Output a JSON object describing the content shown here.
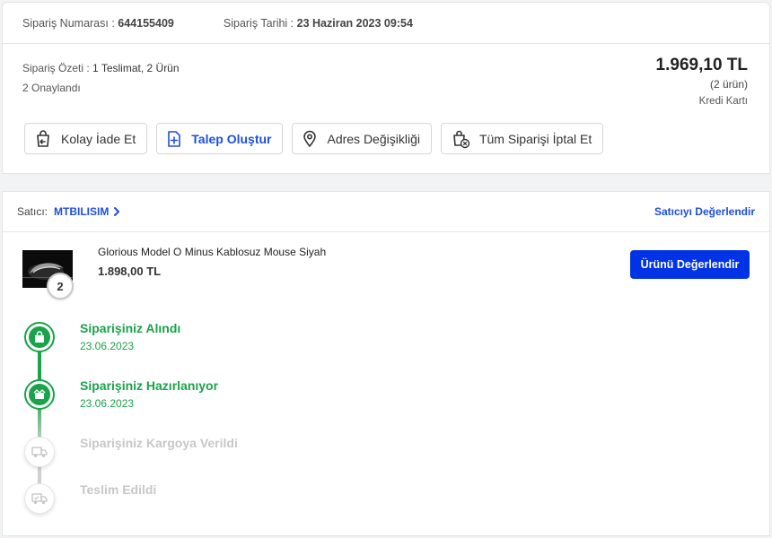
{
  "header": {
    "order_no_label": "Sipariş Numarası :",
    "order_no": "644155409",
    "order_date_label": "Sipariş Tarihi :",
    "order_date": "23 Haziran 2023 09:54"
  },
  "summary": {
    "label": "Sipariş Özeti :",
    "value": "1 Teslimat, 2 Ürün",
    "approved": "2 Onaylandı",
    "total": "1.969,10 TL",
    "item_count": "(2 ürün)",
    "payment": "Kredi Kartı"
  },
  "actions": {
    "easy_return": "Kolay İade Et",
    "create_request": "Talep Oluştur",
    "address_change": "Adres Değişikliği",
    "cancel_all": "Tüm Siparişi İptal Et"
  },
  "seller": {
    "label": "Satıcı:",
    "name": "MTBILISIM",
    "rate_link": "Satıcıyı Değerlendir"
  },
  "product": {
    "name": "Glorious Model O Minus Kablosuz Mouse Siyah",
    "price": "1.898,00 TL",
    "quantity": "2",
    "rate_button": "Ürünü Değerlendir"
  },
  "timeline": {
    "steps": [
      {
        "title": "Siparişiniz Alındı",
        "date": "23.06.2023",
        "status": "done",
        "icon": "shopping-bag-icon"
      },
      {
        "title": "Siparişiniz Hazırlanıyor",
        "date": "23.06.2023",
        "status": "done",
        "icon": "box-icon"
      },
      {
        "title": "Siparişiniz Kargoya Verildi",
        "date": "",
        "status": "pending",
        "icon": "truck-icon"
      },
      {
        "title": "Teslim Edildi",
        "date": "",
        "status": "pending",
        "icon": "delivered-truck-icon"
      }
    ]
  },
  "colors": {
    "accent": "#1e4fe0",
    "button": "#0033e6",
    "success": "#1aa34a",
    "inactive": "#c7c7c7"
  }
}
